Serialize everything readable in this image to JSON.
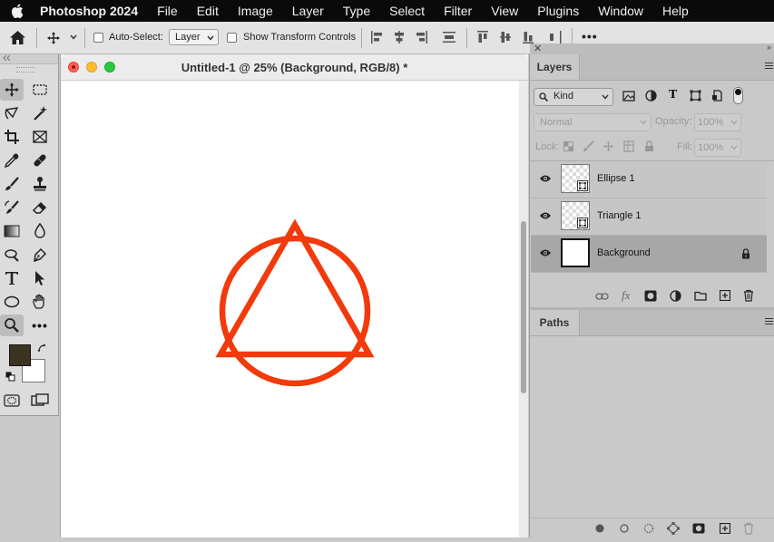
{
  "menubar": {
    "app_name": "Photoshop 2024",
    "items": [
      "File",
      "Edit",
      "Image",
      "Layer",
      "Type",
      "Select",
      "Filter",
      "View",
      "Plugins",
      "Window",
      "Help"
    ]
  },
  "options_bar": {
    "auto_select_label": "Auto-Select:",
    "auto_select_value": "Layer",
    "show_transform_label": "Show Transform Controls",
    "more_label": "•••"
  },
  "toolbar": {
    "foreground_color": "#3b3220",
    "background_color": "#ffffff"
  },
  "document": {
    "title": "Untitled-1 @ 25% (Background, RGB/8) *",
    "shapes": [
      {
        "name": "Ellipse 1",
        "type": "ellipse",
        "stroke": "#f23a0c"
      },
      {
        "name": "Triangle 1",
        "type": "triangle",
        "stroke": "#f23a0c"
      }
    ]
  },
  "layers_panel": {
    "tab_label": "Layers",
    "filter_kind": "Kind",
    "blend_mode": "Normal",
    "opacity_label": "Opacity:",
    "opacity_value": "100%",
    "lock_label": "Lock:",
    "fill_label": "Fill:",
    "fill_value": "100%",
    "layers": [
      {
        "name": "Ellipse 1",
        "visible": true,
        "kind": "shape",
        "locked": false,
        "selected": false
      },
      {
        "name": "Triangle 1",
        "visible": true,
        "kind": "shape",
        "locked": false,
        "selected": false
      },
      {
        "name": "Background",
        "visible": true,
        "kind": "pixel",
        "locked": true,
        "selected": true
      }
    ]
  },
  "paths_panel": {
    "tab_label": "Paths"
  },
  "colors": {
    "shape_stroke": "#f23a0c",
    "menubar_bg": "#0a0a0a",
    "panel_bg": "#c9c9c9",
    "selected_layer_bg": "#a7a7a7"
  }
}
